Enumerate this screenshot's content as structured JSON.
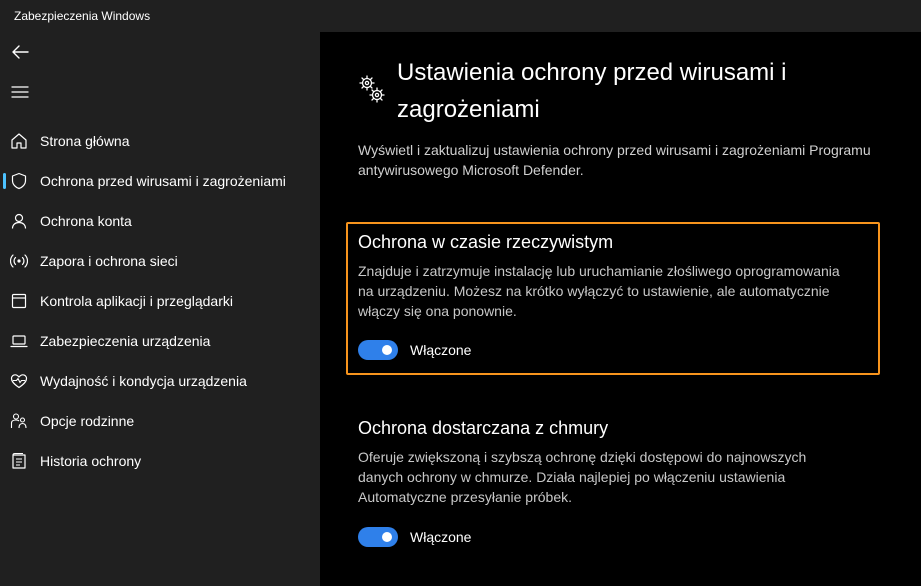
{
  "window": {
    "title": "Zabezpieczenia Windows"
  },
  "sidebar": {
    "back_icon": "back-arrow-icon",
    "menu_icon": "hamburger-menu-icon",
    "items": [
      {
        "label": "Strona główna",
        "icon": "home-icon",
        "active": false
      },
      {
        "label": "Ochrona przed wirusami i zagrożeniami",
        "icon": "shield-icon",
        "active": true
      },
      {
        "label": "Ochrona konta",
        "icon": "person-icon",
        "active": false
      },
      {
        "label": "Zapora i ochrona sieci",
        "icon": "antenna-icon",
        "active": false
      },
      {
        "label": "Kontrola aplikacji i przeglądarki",
        "icon": "app-window-icon",
        "active": false
      },
      {
        "label": "Zabezpieczenia urządzenia",
        "icon": "laptop-icon",
        "active": false
      },
      {
        "label": "Wydajność i kondycja urządzenia",
        "icon": "heart-pulse-icon",
        "active": false
      },
      {
        "label": "Opcje rodzinne",
        "icon": "family-icon",
        "active": false
      },
      {
        "label": "Historia ochrony",
        "icon": "history-icon",
        "active": false
      }
    ]
  },
  "main": {
    "icon": "gears-icon",
    "title": "Ustawienia ochrony przed wirusami i zagrożeniami",
    "description": "Wyświetl i zaktualizuj ustawienia ochrony przed wirusami i zagrożeniami Programu antywirusowego Microsoft Defender.",
    "sections": {
      "realtime": {
        "title": "Ochrona w czasie rzeczywistym",
        "description": "Znajduje i zatrzymuje instalację lub uruchamianie złośliwego oprogramowania na urządzeniu. Możesz na krótko wyłączyć to ustawienie, ale automatycznie włączy się ona ponownie.",
        "toggle_label": "Włączone",
        "toggle_on": true
      },
      "cloud": {
        "title": "Ochrona dostarczana z chmury",
        "description": "Oferuje zwiększoną i szybszą ochronę dzięki dostępowi do najnowszych danych ochrony w chmurze. Działa najlepiej po włączeniu ustawienia Automatyczne przesyłanie próbek.",
        "toggle_label": "Włączone",
        "toggle_on": true
      }
    }
  },
  "colors": {
    "sidebar_bg": "#202020",
    "main_bg": "#000000",
    "toggle_on": "#2f80ea",
    "focus_outline": "#f7941d",
    "active_indicator": "#4cc2ff"
  }
}
